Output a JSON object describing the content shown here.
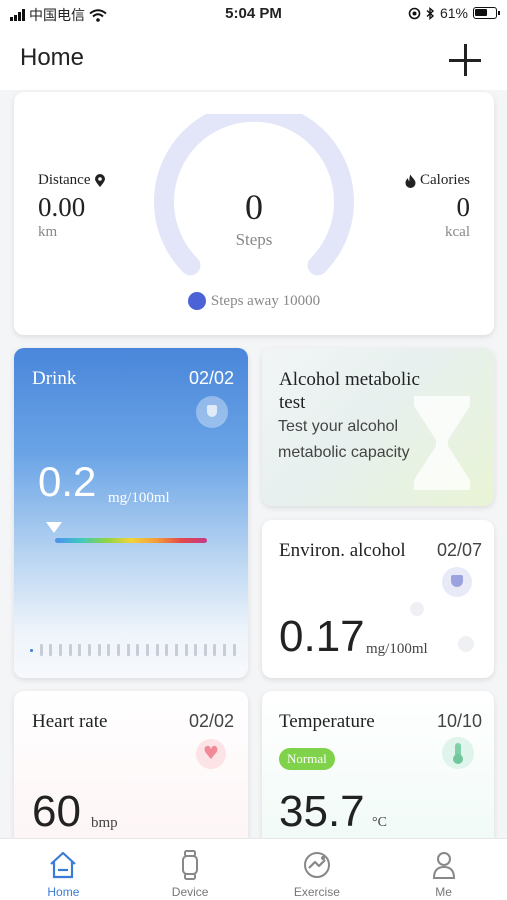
{
  "status_bar": {
    "carrier": "中国电信",
    "time": "5:04 PM",
    "battery": "61%"
  },
  "header": {
    "title": "Home",
    "add_icon": "plus-icon"
  },
  "summary": {
    "distance_label": "Distance",
    "distance_value": "0.00",
    "distance_unit": "km",
    "calories_label": "Calories",
    "calories_value": "0",
    "calories_unit": "kcal",
    "steps_value": "0",
    "steps_label": "Steps",
    "steps_goal": "Steps away 10000",
    "steps_progress_fraction": 0,
    "gauge_color": "#e3e6f8"
  },
  "drink": {
    "name": "Drink",
    "date": "02/02",
    "value": "0.2",
    "unit": "mg/100ml",
    "accent": "#4a86da"
  },
  "alcohol_test": {
    "title": "Alcohol metabolic test",
    "description": "Test your alcohol metabolic capacity"
  },
  "environ_alcohol": {
    "name": "Environ. alcohol",
    "date": "02/07",
    "value": "0.17",
    "unit": "mg/100ml"
  },
  "heart_rate": {
    "name": "Heart rate",
    "date": "02/02",
    "value": "60",
    "unit": "bmp"
  },
  "temperature": {
    "name": "Temperature",
    "date": "10/10",
    "status": "Normal",
    "value": "35.7",
    "unit": "°C",
    "status_color": "#7fd24a"
  },
  "tabs": [
    {
      "label": "Home",
      "icon": "home-icon",
      "active": true
    },
    {
      "label": "Device",
      "icon": "watch-icon",
      "active": false
    },
    {
      "label": "Exercise",
      "icon": "exercise-icon",
      "active": false
    },
    {
      "label": "Me",
      "icon": "person-icon",
      "active": false
    }
  ],
  "active_color": "#3a7bd5"
}
